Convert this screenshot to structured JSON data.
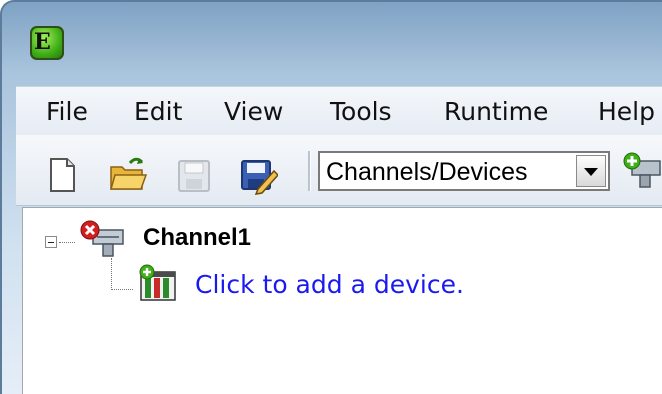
{
  "app": {
    "logo_text": "E"
  },
  "menu": {
    "items": [
      "File",
      "Edit",
      "View",
      "Tools",
      "Runtime",
      "Help"
    ]
  },
  "toolbar": {
    "buttons": [
      "new-document-icon",
      "open-folder-icon",
      "save-disabled-icon",
      "save-as-icon",
      "add-channel-icon"
    ],
    "view_selector": {
      "selected": "Channels/Devices"
    }
  },
  "tree": {
    "channel": {
      "label": "Channel1",
      "status": "error"
    },
    "device_placeholder": {
      "label": "Click to add a device."
    }
  },
  "colors": {
    "link": "#1a1af0",
    "error": "#d31f1f",
    "logo": "#3fae17"
  }
}
